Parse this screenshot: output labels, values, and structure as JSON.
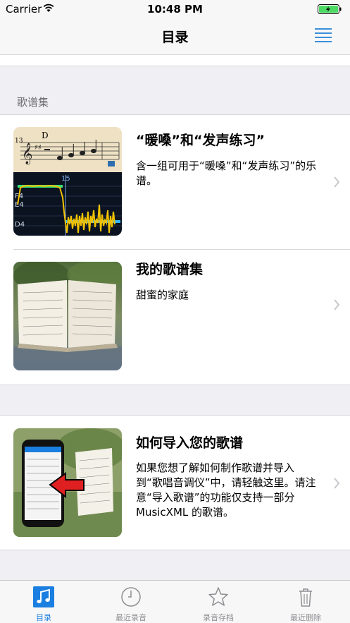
{
  "status_bar": {
    "carrier": "Carrier",
    "time": "10:48 PM"
  },
  "nav": {
    "title": "目录",
    "menu_icon": "list-icon"
  },
  "section": {
    "header": "歌谱集"
  },
  "cells": [
    {
      "title": "“暖嗓”和“发声练习”",
      "description": "含一组可用于“暖嗓”和“发声练习”的乐谱。",
      "thumb": {
        "measure_number": "13",
        "chord": "D",
        "beat_label": "15",
        "pitch_labels": [
          "F4",
          "E4",
          "D4"
        ]
      }
    },
    {
      "title": "我的歌谱集",
      "description": "甜蜜的家庭"
    },
    {
      "title": "如何导入您的歌谱",
      "description": "如果您想了解如何制作歌谱并导入到“歌唱音调仪”中，请轻触这里。请注意“导入歌谱”的功能仅支持一部分MusicXML 的歌谱。"
    }
  ],
  "tabs": [
    {
      "label": "目录",
      "icon": "music-note-icon",
      "active": true
    },
    {
      "label": "最近录音",
      "icon": "clock-icon",
      "active": false
    },
    {
      "label": "录音存档",
      "icon": "star-icon",
      "active": false
    },
    {
      "label": "最近删除",
      "icon": "trash-icon",
      "active": false
    }
  ],
  "colors": {
    "accent": "#1a7fe0",
    "pitch_line_yellow": "#f2c200",
    "pitch_target_green": "#38e07a",
    "pitch_target_blue": "#2fb5ff"
  }
}
